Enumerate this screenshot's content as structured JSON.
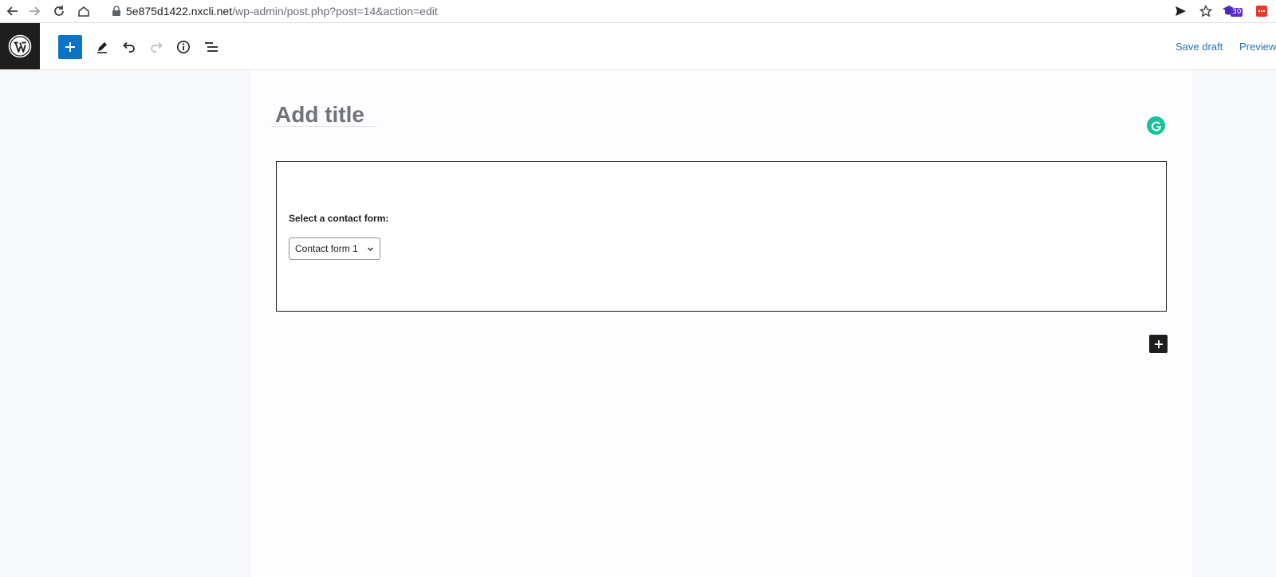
{
  "browser": {
    "url_host": "5e875d1422.nxcli.net",
    "url_path": "/wp-admin/post.php?post=14&action=edit",
    "extension_badge": "30"
  },
  "header": {
    "save_draft_label": "Save draft",
    "preview_label": "Preview"
  },
  "editor": {
    "title_placeholder": "Add title",
    "contact_form_block": {
      "label": "Select a contact form:",
      "selected_form": "Contact form 1"
    }
  },
  "colors": {
    "accent": "#0a73c6",
    "link": "#1f75c2",
    "grammarly": "#15c39a"
  }
}
